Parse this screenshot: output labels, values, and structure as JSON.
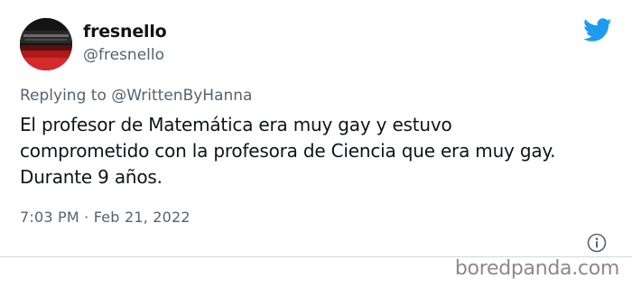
{
  "tweet": {
    "author_name": "fresnello",
    "author_handle": "@fresnello",
    "replying_prefix": "Replying to",
    "replying_handle": "@WrittenByHanna",
    "text": "El profesor de Matemática era muy gay y estuvo\ncomprometido con la profesora de Ciencia que era muy gay.\nDurante 9 años.",
    "timestamp": "7:03 PM · Feb 21, 2022"
  },
  "icons": {
    "brand": "twitter-bird-icon",
    "info": "info-icon"
  },
  "watermark": "boredpanda.com",
  "colors": {
    "twitter_blue": "#1d9bf0",
    "text_primary": "#0f1419",
    "text_secondary": "#536471",
    "watermark": "#8a8a8a"
  }
}
